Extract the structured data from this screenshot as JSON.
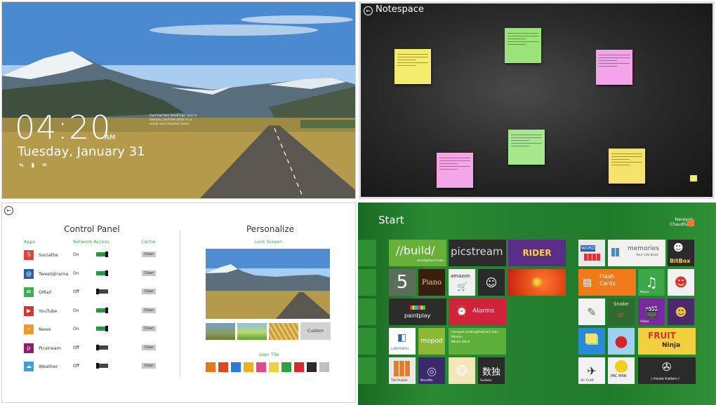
{
  "lock_screen": {
    "time": "04:20",
    "ampm": "AM",
    "date": "Tuesday, January 31",
    "quote": "God has two dwellings; one in heaven, and the other in a meek and thankful heart.",
    "icons": [
      "network-icon",
      "battery-icon",
      "mail-icon"
    ]
  },
  "notespace": {
    "title": "Notespace",
    "notes": [
      {
        "color": "#f5ec6e",
        "line1": "Install is almost watching",
        "line2": "tomorrow at"
      },
      {
        "color": "#9ce27b",
        "line1": "Watching this video is very",
        "line2": "tomorrow at"
      },
      {
        "color": "#f3a4e8",
        "line1": "Install is almost watching",
        "line2": "tomorrow at"
      },
      {
        "color": "#a8e88c",
        "line1": "Watching this video is very",
        "line2": "tomorrow at"
      },
      {
        "color": "#f3a7e8",
        "line1": "Install is almost watching",
        "line2": "tomorrow at"
      },
      {
        "color": "#f5e36e",
        "line1": "Install is almost watching",
        "line2": "tomorrow at"
      }
    ]
  },
  "control_panel": {
    "title": "Control Panel",
    "headers": {
      "apps": "Apps",
      "network": "Network Access",
      "cache": "Cache"
    },
    "clear_label": "Clear",
    "rows": [
      {
        "name": "Socialite",
        "net": "On",
        "on": true,
        "icon_color": "#e0443a",
        "glyph": "S"
      },
      {
        "name": "Tweet@rama",
        "net": "On",
        "on": true,
        "icon_color": "#2a5ea8",
        "glyph": "@"
      },
      {
        "name": "GMail",
        "net": "Off",
        "on": false,
        "icon_color": "#3bb04c",
        "glyph": "✉"
      },
      {
        "name": "YouTube",
        "net": "On",
        "on": true,
        "icon_color": "#d8322c",
        "glyph": "▶"
      },
      {
        "name": "News",
        "net": "On",
        "on": true,
        "icon_color": "#f19a2a",
        "glyph": "⌁"
      },
      {
        "name": "Picstream",
        "net": "Off",
        "on": false,
        "icon_color": "#8a1e6f",
        "glyph": "p"
      },
      {
        "name": "Weather",
        "net": "Off",
        "on": false,
        "icon_color": "#3aa0d8",
        "glyph": "☁"
      }
    ]
  },
  "personalize": {
    "title": "Personalize",
    "lock_screen_label": "Lock Screen",
    "custom_label": "Custom",
    "user_tile_label": "User Tile"
  },
  "start": {
    "title": "Start",
    "user_first": "Narayan",
    "user_last": "Chaudhary",
    "tiles": {
      "build": "//build/",
      "build_sub": "development team",
      "picstream": "picstream",
      "five": "5",
      "piano": "Piano",
      "amazon": "amazon",
      "paintplay": "paintplay",
      "alarms": "Alarms",
      "labyrinth": "LABYRINTH",
      "mopod": "mopod",
      "email_from": "narayan.soubo@hotmail.com",
      "email_subject": "Movies",
      "email_line": "Movie Hitch",
      "tile_puzzle": "Tile Puzzle",
      "nearme": "NearMe",
      "sudoku_label": "Sudoku",
      "sudoku": "数独",
      "word": "WORD",
      "memories": "memories",
      "memories_sub": "Your Life Book",
      "bitbox": "BitBox",
      "flash_cards": "Flash Cards",
      "music": "Music",
      "snake": "Snake",
      "snake_sub": "3D",
      "video": "Video",
      "fruit": "FRUIT",
      "ninja": "Ninja",
      "air_craft": "Air Craft",
      "pac": "PAC",
      "pac2": "MAN",
      "movie_trailers": "/ movie trailers /",
      "tropic": "RIDER"
    }
  }
}
